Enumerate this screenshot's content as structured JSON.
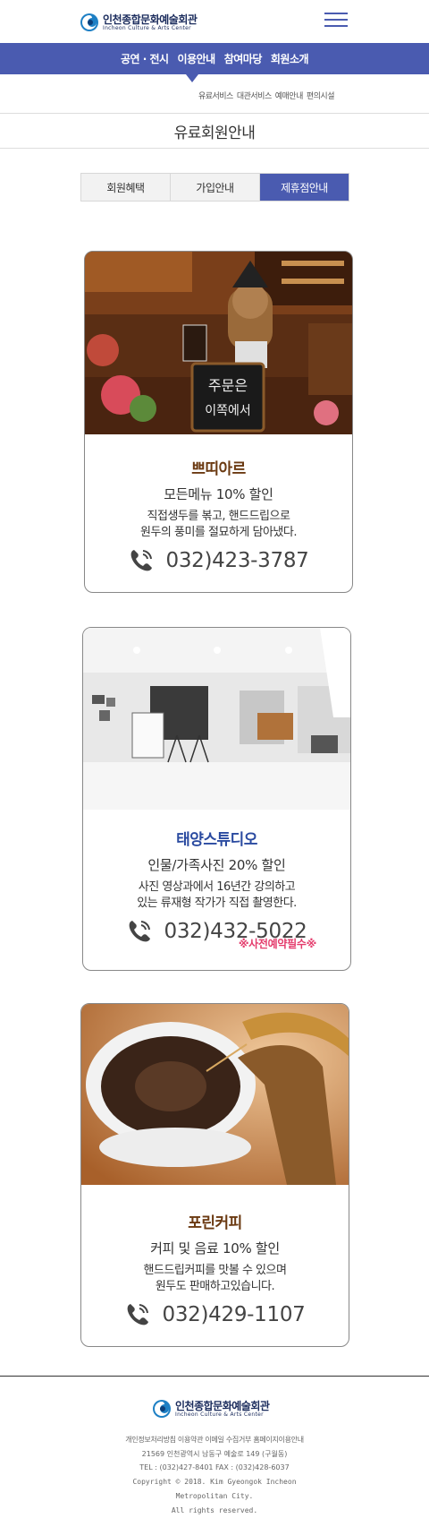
{
  "header": {
    "logo_name": "인천종합문화예술회관",
    "logo_sub": "Incheon Culture & Arts Center"
  },
  "nav": {
    "items": [
      "공연 · 전시",
      "이용안내",
      "참여마당",
      "회원소개"
    ]
  },
  "subnav": {
    "items": [
      "유료서비스",
      "대관서비스",
      "예매안내",
      "편의시설"
    ]
  },
  "page_title": "유료회원안내",
  "tabs": [
    "회원혜택",
    "가입안내",
    "제휴점안내"
  ],
  "cards": [
    {
      "name": "쁘띠아르",
      "name_color": "#6b3a12",
      "discount": "모든메뉴 10% 할인",
      "desc1": "직접생두를 볶고, 핸드드립으로",
      "desc2": "원두의 풍미를 절묘하게 담아냈다.",
      "phone": "032)423-3787",
      "photo_sign_1": "주문은",
      "photo_sign_2": "이쪽에서"
    },
    {
      "name": "태양스튜디오",
      "name_color": "#2a4aa0",
      "discount": "인물/가족사진 20% 할인",
      "desc1": "사진 영상과에서 16년간 강의하고",
      "desc2": "있는 류재형 작가가 직접 촬영한다.",
      "phone": "032)432-5022",
      "note": "※사전예약필수※"
    },
    {
      "name": "포린커피",
      "name_color": "#6b3a12",
      "discount": "커피 및 음료 10% 할인",
      "desc1": "핸드드립커피를 맛볼 수 있으며",
      "desc2": "원두도 판매하고있습니다.",
      "phone": "032)429-1107"
    }
  ],
  "footer": {
    "logo_name": "인천종합문화예술회관",
    "logo_sub": "Incheon Culture & Arts Center",
    "links": "개인정보처리방침  이용약관  이메일 수집거부  홈페이지이용안내",
    "address": "21569 인천광역시 남동구 예술로 149 (구월동)",
    "tel": "TEL : (032)427-8401  FAX : (032)428-6037",
    "copyright1": "Copyright © 2018. Kim Gyeongok Incheon",
    "copyright2": "Metropolitan City.",
    "copyright3": "All rights reserved."
  },
  "colors": {
    "brand": "#4a5bb0",
    "note": "#e43c6c"
  }
}
